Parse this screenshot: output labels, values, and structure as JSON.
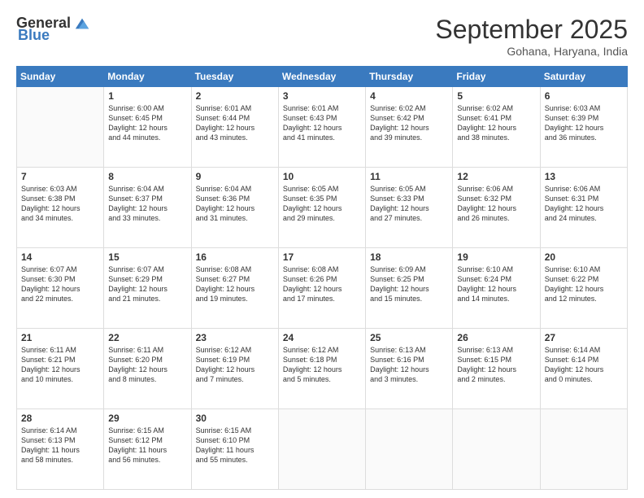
{
  "logo": {
    "general": "General",
    "blue": "Blue"
  },
  "header": {
    "month": "September 2025",
    "location": "Gohana, Haryana, India"
  },
  "days": [
    "Sunday",
    "Monday",
    "Tuesday",
    "Wednesday",
    "Thursday",
    "Friday",
    "Saturday"
  ],
  "weeks": [
    [
      {
        "num": "",
        "lines": []
      },
      {
        "num": "1",
        "lines": [
          "Sunrise: 6:00 AM",
          "Sunset: 6:45 PM",
          "Daylight: 12 hours",
          "and 44 minutes."
        ]
      },
      {
        "num": "2",
        "lines": [
          "Sunrise: 6:01 AM",
          "Sunset: 6:44 PM",
          "Daylight: 12 hours",
          "and 43 minutes."
        ]
      },
      {
        "num": "3",
        "lines": [
          "Sunrise: 6:01 AM",
          "Sunset: 6:43 PM",
          "Daylight: 12 hours",
          "and 41 minutes."
        ]
      },
      {
        "num": "4",
        "lines": [
          "Sunrise: 6:02 AM",
          "Sunset: 6:42 PM",
          "Daylight: 12 hours",
          "and 39 minutes."
        ]
      },
      {
        "num": "5",
        "lines": [
          "Sunrise: 6:02 AM",
          "Sunset: 6:41 PM",
          "Daylight: 12 hours",
          "and 38 minutes."
        ]
      },
      {
        "num": "6",
        "lines": [
          "Sunrise: 6:03 AM",
          "Sunset: 6:39 PM",
          "Daylight: 12 hours",
          "and 36 minutes."
        ]
      }
    ],
    [
      {
        "num": "7",
        "lines": [
          "Sunrise: 6:03 AM",
          "Sunset: 6:38 PM",
          "Daylight: 12 hours",
          "and 34 minutes."
        ]
      },
      {
        "num": "8",
        "lines": [
          "Sunrise: 6:04 AM",
          "Sunset: 6:37 PM",
          "Daylight: 12 hours",
          "and 33 minutes."
        ]
      },
      {
        "num": "9",
        "lines": [
          "Sunrise: 6:04 AM",
          "Sunset: 6:36 PM",
          "Daylight: 12 hours",
          "and 31 minutes."
        ]
      },
      {
        "num": "10",
        "lines": [
          "Sunrise: 6:05 AM",
          "Sunset: 6:35 PM",
          "Daylight: 12 hours",
          "and 29 minutes."
        ]
      },
      {
        "num": "11",
        "lines": [
          "Sunrise: 6:05 AM",
          "Sunset: 6:33 PM",
          "Daylight: 12 hours",
          "and 27 minutes."
        ]
      },
      {
        "num": "12",
        "lines": [
          "Sunrise: 6:06 AM",
          "Sunset: 6:32 PM",
          "Daylight: 12 hours",
          "and 26 minutes."
        ]
      },
      {
        "num": "13",
        "lines": [
          "Sunrise: 6:06 AM",
          "Sunset: 6:31 PM",
          "Daylight: 12 hours",
          "and 24 minutes."
        ]
      }
    ],
    [
      {
        "num": "14",
        "lines": [
          "Sunrise: 6:07 AM",
          "Sunset: 6:30 PM",
          "Daylight: 12 hours",
          "and 22 minutes."
        ]
      },
      {
        "num": "15",
        "lines": [
          "Sunrise: 6:07 AM",
          "Sunset: 6:29 PM",
          "Daylight: 12 hours",
          "and 21 minutes."
        ]
      },
      {
        "num": "16",
        "lines": [
          "Sunrise: 6:08 AM",
          "Sunset: 6:27 PM",
          "Daylight: 12 hours",
          "and 19 minutes."
        ]
      },
      {
        "num": "17",
        "lines": [
          "Sunrise: 6:08 AM",
          "Sunset: 6:26 PM",
          "Daylight: 12 hours",
          "and 17 minutes."
        ]
      },
      {
        "num": "18",
        "lines": [
          "Sunrise: 6:09 AM",
          "Sunset: 6:25 PM",
          "Daylight: 12 hours",
          "and 15 minutes."
        ]
      },
      {
        "num": "19",
        "lines": [
          "Sunrise: 6:10 AM",
          "Sunset: 6:24 PM",
          "Daylight: 12 hours",
          "and 14 minutes."
        ]
      },
      {
        "num": "20",
        "lines": [
          "Sunrise: 6:10 AM",
          "Sunset: 6:22 PM",
          "Daylight: 12 hours",
          "and 12 minutes."
        ]
      }
    ],
    [
      {
        "num": "21",
        "lines": [
          "Sunrise: 6:11 AM",
          "Sunset: 6:21 PM",
          "Daylight: 12 hours",
          "and 10 minutes."
        ]
      },
      {
        "num": "22",
        "lines": [
          "Sunrise: 6:11 AM",
          "Sunset: 6:20 PM",
          "Daylight: 12 hours",
          "and 8 minutes."
        ]
      },
      {
        "num": "23",
        "lines": [
          "Sunrise: 6:12 AM",
          "Sunset: 6:19 PM",
          "Daylight: 12 hours",
          "and 7 minutes."
        ]
      },
      {
        "num": "24",
        "lines": [
          "Sunrise: 6:12 AM",
          "Sunset: 6:18 PM",
          "Daylight: 12 hours",
          "and 5 minutes."
        ]
      },
      {
        "num": "25",
        "lines": [
          "Sunrise: 6:13 AM",
          "Sunset: 6:16 PM",
          "Daylight: 12 hours",
          "and 3 minutes."
        ]
      },
      {
        "num": "26",
        "lines": [
          "Sunrise: 6:13 AM",
          "Sunset: 6:15 PM",
          "Daylight: 12 hours",
          "and 2 minutes."
        ]
      },
      {
        "num": "27",
        "lines": [
          "Sunrise: 6:14 AM",
          "Sunset: 6:14 PM",
          "Daylight: 12 hours",
          "and 0 minutes."
        ]
      }
    ],
    [
      {
        "num": "28",
        "lines": [
          "Sunrise: 6:14 AM",
          "Sunset: 6:13 PM",
          "Daylight: 11 hours",
          "and 58 minutes."
        ]
      },
      {
        "num": "29",
        "lines": [
          "Sunrise: 6:15 AM",
          "Sunset: 6:12 PM",
          "Daylight: 11 hours",
          "and 56 minutes."
        ]
      },
      {
        "num": "30",
        "lines": [
          "Sunrise: 6:15 AM",
          "Sunset: 6:10 PM",
          "Daylight: 11 hours",
          "and 55 minutes."
        ]
      },
      {
        "num": "",
        "lines": []
      },
      {
        "num": "",
        "lines": []
      },
      {
        "num": "",
        "lines": []
      },
      {
        "num": "",
        "lines": []
      }
    ]
  ]
}
